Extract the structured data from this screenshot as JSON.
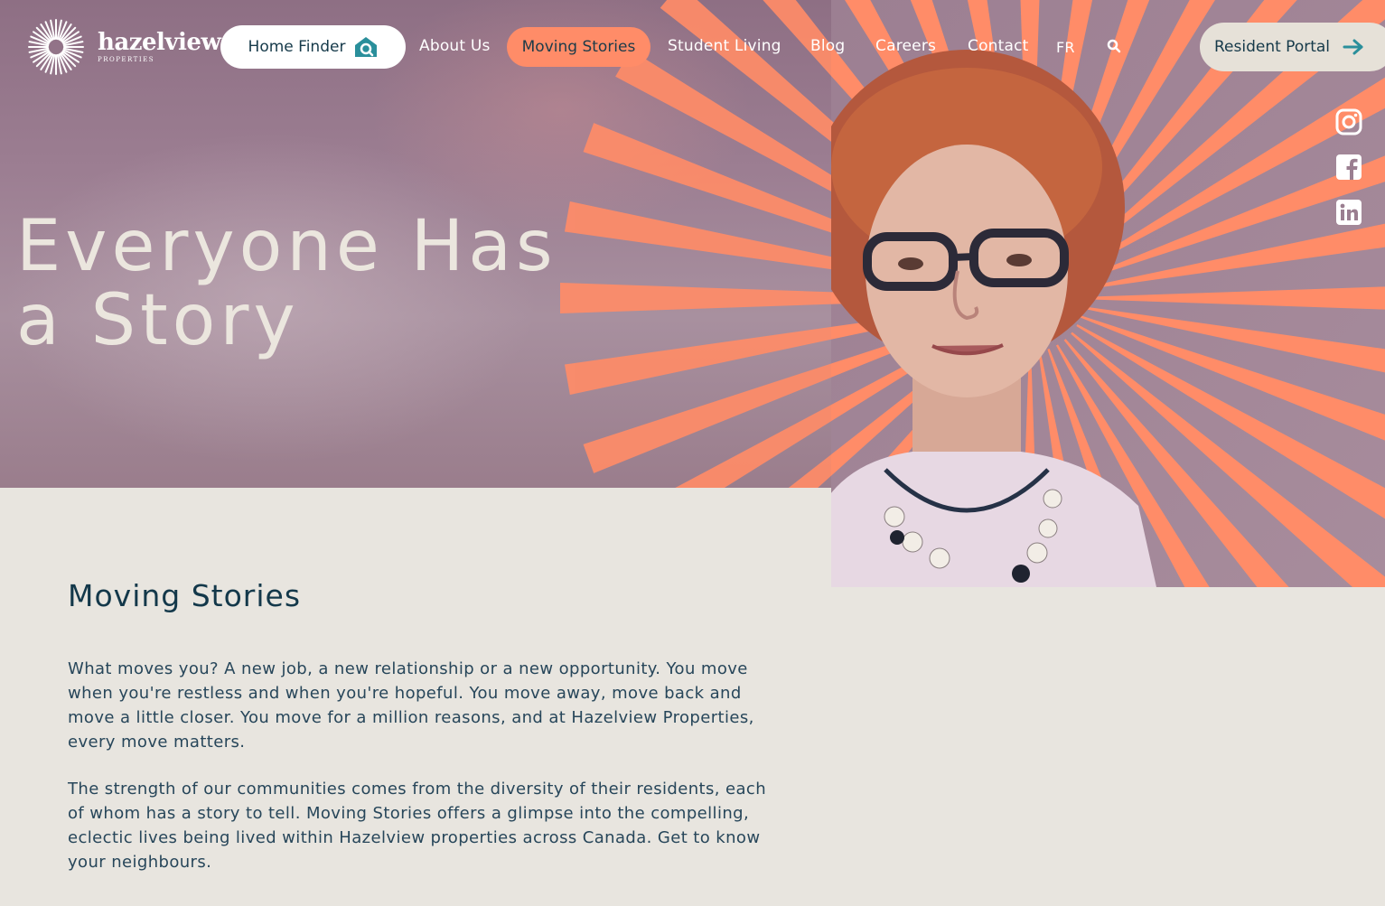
{
  "brand": {
    "name": "hazelview",
    "subtitle": "PROPERTIES",
    "logo_icon": "sunburst-logo-icon"
  },
  "nav": {
    "home_finder": "Home Finder",
    "home_finder_icon": "house-search-icon",
    "items": [
      {
        "label": "About Us"
      },
      {
        "label": "Moving Stories",
        "active": true
      },
      {
        "label": "Student Living"
      },
      {
        "label": "Blog"
      },
      {
        "label": "Careers"
      },
      {
        "label": "Contact"
      },
      {
        "label": "FR"
      }
    ],
    "search_icon": "search-icon",
    "resident_portal": "Resident Portal",
    "resident_portal_icon": "arrow-right-icon"
  },
  "social": [
    {
      "icon": "instagram-icon"
    },
    {
      "icon": "facebook-icon"
    },
    {
      "icon": "linkedin-icon"
    }
  ],
  "hero": {
    "title_line1": "Everyone Has",
    "title_line2": "a Story"
  },
  "content": {
    "heading": "Moving Stories",
    "paragraph1": "What moves you? A new job, a new relationship or a new opportunity. You move when you're restless and when you're hopeful. You move away, move back and move a little closer. You move for a million reasons, and at Hazelview Properties, every move matters.",
    "paragraph2": "The strength of our communities comes from the diversity of their residents, each of whom has a story to tell. Moving Stories offers a glimpse into the compelling, eclectic lives being lived within Hazelview properties across Canada. Get to know your neighbours."
  },
  "colors": {
    "accent": "#ff8c68",
    "navy": "#163a4a",
    "teal": "#2a8f9b",
    "background": "#e8e5df"
  }
}
